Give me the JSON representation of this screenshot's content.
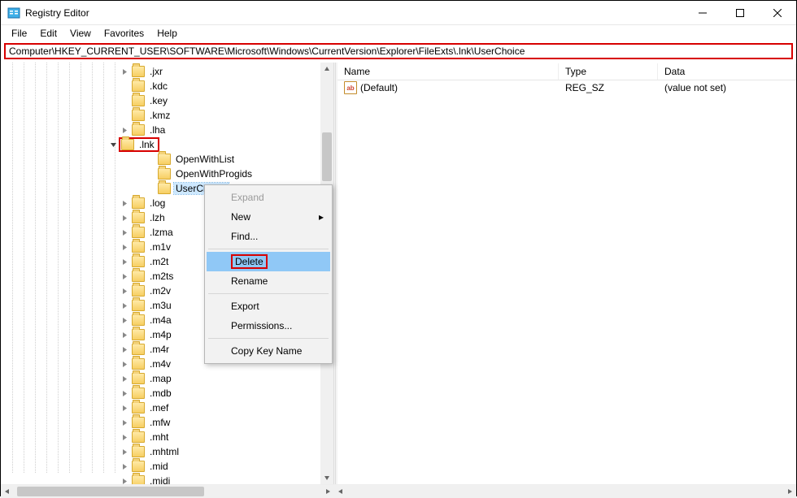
{
  "window": {
    "title": "Registry Editor"
  },
  "menus": {
    "file": "File",
    "edit": "Edit",
    "view": "View",
    "favorites": "Favorites",
    "help": "Help"
  },
  "address": "Computer\\HKEY_CURRENT_USER\\SOFTWARE\\Microsoft\\Windows\\CurrentVersion\\Explorer\\FileExts\\.lnk\\UserChoice",
  "tree": {
    "items": [
      {
        "label": ".jxr",
        "depth": "normal",
        "twisty": "closed"
      },
      {
        "label": ".kdc",
        "depth": "normal",
        "twisty": "none"
      },
      {
        "label": ".key",
        "depth": "normal",
        "twisty": "none"
      },
      {
        "label": ".kmz",
        "depth": "normal",
        "twisty": "none"
      },
      {
        "label": ".lha",
        "depth": "normal",
        "twisty": "closed"
      },
      {
        "label": ".lnk",
        "depth": "parent",
        "twisty": "open",
        "red": true
      },
      {
        "label": "OpenWithList",
        "depth": "child",
        "twisty": "none"
      },
      {
        "label": "OpenWithProgids",
        "depth": "child",
        "twisty": "none"
      },
      {
        "label": "UserChoice",
        "depth": "child",
        "twisty": "none",
        "selected": true
      },
      {
        "label": ".log",
        "depth": "normal",
        "twisty": "closed"
      },
      {
        "label": ".lzh",
        "depth": "normal",
        "twisty": "closed"
      },
      {
        "label": ".lzma",
        "depth": "normal",
        "twisty": "closed"
      },
      {
        "label": ".m1v",
        "depth": "normal",
        "twisty": "closed"
      },
      {
        "label": ".m2t",
        "depth": "normal",
        "twisty": "closed"
      },
      {
        "label": ".m2ts",
        "depth": "normal",
        "twisty": "closed"
      },
      {
        "label": ".m2v",
        "depth": "normal",
        "twisty": "closed"
      },
      {
        "label": ".m3u",
        "depth": "normal",
        "twisty": "closed"
      },
      {
        "label": ".m4a",
        "depth": "normal",
        "twisty": "closed"
      },
      {
        "label": ".m4p",
        "depth": "normal",
        "twisty": "closed"
      },
      {
        "label": ".m4r",
        "depth": "normal",
        "twisty": "closed"
      },
      {
        "label": ".m4v",
        "depth": "normal",
        "twisty": "closed"
      },
      {
        "label": ".map",
        "depth": "normal",
        "twisty": "closed"
      },
      {
        "label": ".mdb",
        "depth": "normal",
        "twisty": "closed"
      },
      {
        "label": ".mef",
        "depth": "normal",
        "twisty": "closed"
      },
      {
        "label": ".mfw",
        "depth": "normal",
        "twisty": "closed"
      },
      {
        "label": ".mht",
        "depth": "normal",
        "twisty": "closed"
      },
      {
        "label": ".mhtml",
        "depth": "normal",
        "twisty": "closed"
      },
      {
        "label": ".mid",
        "depth": "normal",
        "twisty": "closed"
      },
      {
        "label": ".midi",
        "depth": "normal",
        "twisty": "closed"
      }
    ]
  },
  "columns": {
    "name": "Name",
    "type": "Type",
    "data": "Data"
  },
  "values": [
    {
      "name": "(Default)",
      "type": "REG_SZ",
      "data": "(value not set)"
    }
  ],
  "context_menu": {
    "expand": "Expand",
    "new": "New",
    "find": "Find...",
    "delete": "Delete",
    "rename": "Rename",
    "export": "Export",
    "permissions": "Permissions...",
    "copy_key": "Copy Key Name"
  }
}
